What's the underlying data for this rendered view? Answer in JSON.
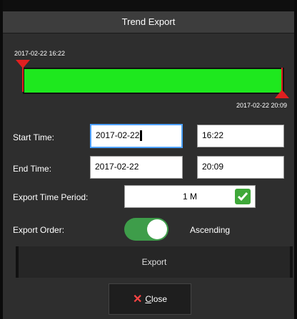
{
  "dialog": {
    "title": "Trend Export"
  },
  "range": {
    "start_label": "2017-02-22 16:22",
    "end_label": "2017-02-22 20:09",
    "bar_color": "#1ee81e",
    "marker_color": "#e02020"
  },
  "start_time": {
    "label": "Start Time:",
    "date": "2017-02-22",
    "time": "16:22"
  },
  "end_time": {
    "label": "End Time:",
    "date": "2017-02-22",
    "time": "20:09"
  },
  "export_period": {
    "label": "Export Time Period:",
    "value": "1 M",
    "checked": true
  },
  "export_order": {
    "label": "Export Order:",
    "value": "Ascending",
    "toggle_on": true,
    "toggle_color": "#3e9d4a"
  },
  "buttons": {
    "export_label": "Export",
    "close_label_accesskey": "C",
    "close_label_rest": "lose",
    "close_icon": "close-x-icon"
  }
}
